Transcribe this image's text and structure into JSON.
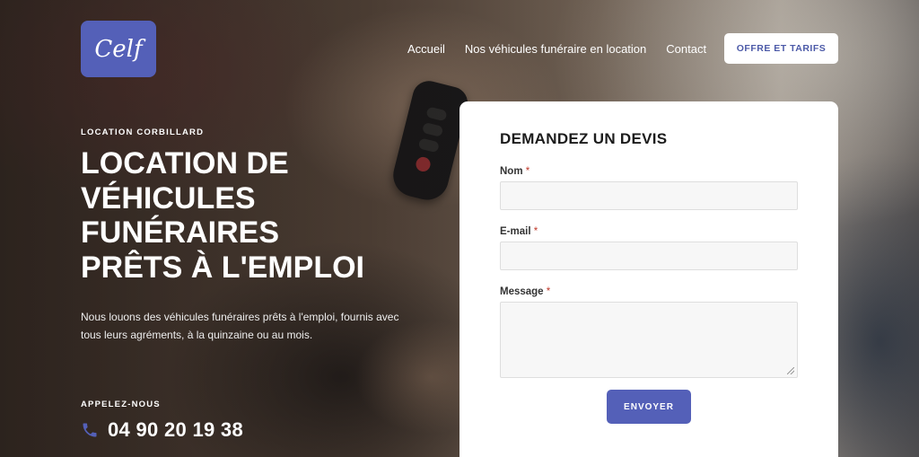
{
  "header": {
    "logo_text": "Celf",
    "nav": [
      "Accueil",
      "Nos véhicules funéraire en location",
      "Contact"
    ],
    "cta_label": "OFFRE ET TARIFS"
  },
  "hero": {
    "eyebrow": "LOCATION CORBILLARD",
    "headline_lines": [
      "LOCATION DE",
      "VÉHICULES",
      "FUNÉRAIRES",
      "PRÊTS À L'EMPLOI"
    ],
    "description": "Nous louons des véhicules funéraires prêts à l'emploi, fournis avec tous leurs agréments, à la quinzaine ou au mois.",
    "call_label": "APPELEZ-NOUS",
    "phone": "04 90 20 19 38"
  },
  "form": {
    "title": "DEMANDEZ UN DEVIS",
    "fields": [
      {
        "label": "Nom",
        "required_mark": "*",
        "value": ""
      },
      {
        "label": "E-mail",
        "required_mark": "*",
        "value": ""
      },
      {
        "label": "Message",
        "required_mark": "*",
        "value": ""
      }
    ],
    "submit_label": "ENVOYER"
  },
  "colors": {
    "accent": "#5460b8",
    "required": "#c0392b"
  }
}
